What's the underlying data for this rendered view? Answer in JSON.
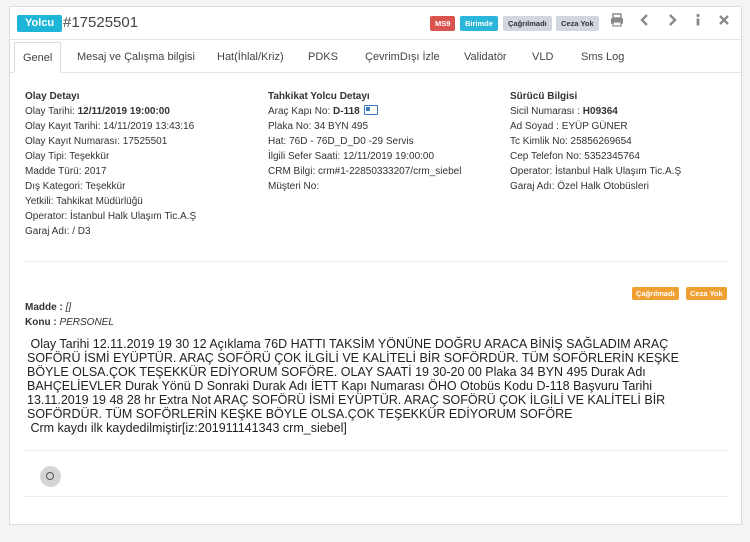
{
  "header": {
    "type_badge": "Yolcu",
    "record_id": "#17525501",
    "badges": [
      "MS9",
      "Birimde",
      "Çağrılmadı",
      "Ceza Yok"
    ],
    "tools": [
      "print-icon",
      "chevron-left-icon",
      "chevron-right-icon",
      "info-icon",
      "close-icon"
    ]
  },
  "tabs": [
    "Genel",
    "Mesaj ve Çalışma bilgisi",
    "Hat(İhlal/Kriz)",
    "PDKS",
    "ÇevrimDışı İzle",
    "Validatör",
    "VLD",
    "Sms Log"
  ],
  "olay": {
    "title": "Olay Detayı",
    "tarih_label": "Olay Tarihi: ",
    "tarih_value": "12/11/2019 19:00:00",
    "rows": [
      "Olay Kayıt Tarihi: 14/11/2019 13:43:16",
      "Olay Kayıt Numarası: 17525501",
      "Olay Tipi: Teşekkür",
      "Madde Türü: 2017",
      "Dış Kategori: Teşekkür",
      "Yetkili: Tahkikat Müdürlüğü",
      "Operator: İstanbul Halk Ulaşım Tic.A.Ş",
      "Garaj Adı: / D3"
    ]
  },
  "tahkikat": {
    "title": "Tahkikat Yolcu Detayı",
    "kapi_label": "Araç Kapı No: ",
    "kapi_value": "D-118",
    "rows": [
      "Plaka No: 34 BYN 495",
      "Hat: 76D - 76D_D_D0 -29 Servis",
      "İlgili Sefer Saati: 12/11/2019 19:00:00",
      "CRM Bilgi: crm#1-22850333207/crm_siebel",
      "Müşteri No:"
    ]
  },
  "surucu": {
    "title": "Sürücü Bilgisi",
    "sicil_label": "Sicil Numarası : ",
    "sicil_value": "H09364",
    "rows": [
      "Ad Soyad : EYÜP GÜNER",
      "Tc Kimlik No: 25856269654",
      "Cep Telefon No: 5352345764",
      "Operator: İstanbul Halk Ulaşım Tic.A.Ş",
      "Garaj Adı: Özel Halk Otobüsleri"
    ]
  },
  "status_badges": [
    "Çağrılmadı",
    "Ceza Yok"
  ],
  "madde": {
    "label": "Madde : ",
    "value": "[]"
  },
  "konu": {
    "label": "Konu : ",
    "value": "PERSONEL"
  },
  "description": " Olay Tarihi 12.11.2019 19 30 12 Açıklama 76D HATTI TAKSİM YÖNÜNE DOĞRU ARACA BİNİŞ SAĞLADIM ARAÇ\nSOFÖRÜ İSMİ EYÜPTÜR. ARAÇ SOFÖRÜ ÇOK İLGİLİ VE KALİTELİ BİR SOFÖRDÜR. TÜM SOFÖRLERİN KEŞKE\nBÖYLE OLSA.ÇOK TEŞEKKÜR EDİYORUM SOFÖRE. OLAY SAATİ 19 30-20 00 Plaka 34 BYN 495 Durak Adı\nBAHÇELİEVLER Durak Yönü D Sonraki Durak Adı İETT Kapı Numarası ÖHO Otobüs Kodu D-118 Başvuru Tarihi\n13.11.2019 19 48 28 hr Extra Not ARAÇ SOFÖRÜ İSMİ EYÜPTÜR. ARAÇ SOFÖRÜ ÇOK İLGİLİ VE KALİTELİ BİR\nSOFÖRDÜR. TÜM SOFÖRLERİN KEŞKE BÖYLE OLSA.ÇOK TEŞEKKÜR EDİYORUM SOFÖRE\n Crm kaydı ilk kaydedilmiştir[iz:201911141343 crm_siebel]"
}
